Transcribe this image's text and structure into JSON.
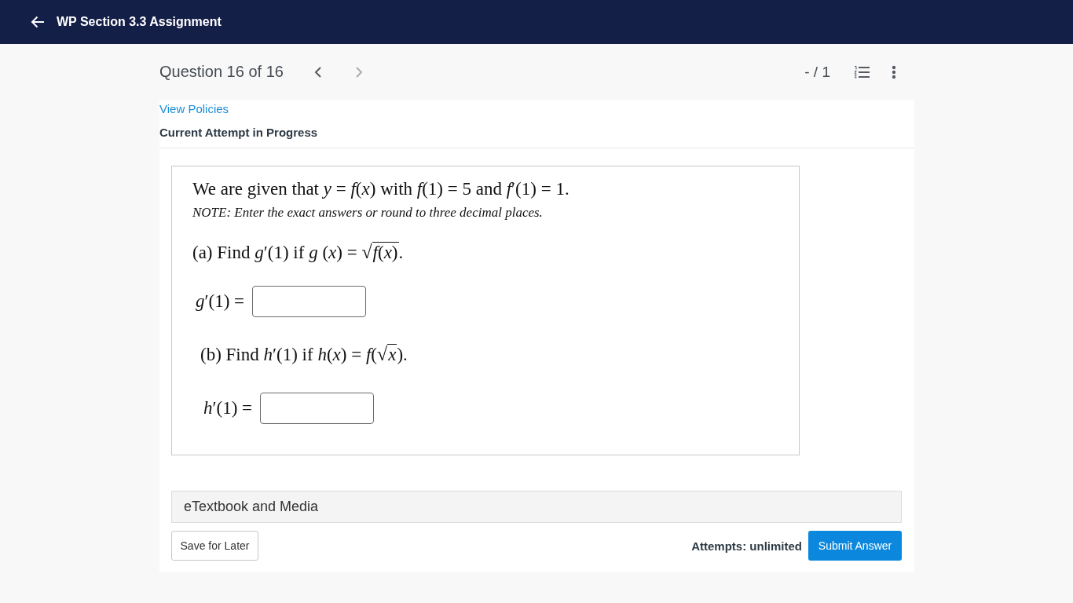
{
  "top_bar": {
    "title": "WP Section 3.3 Assignment"
  },
  "question_nav": {
    "title": "Question 16 of 16",
    "buttons": [
      {
        "kind": "previous",
        "disabled": false
      },
      {
        "kind": "next",
        "disabled": true
      }
    ],
    "score": "- / 1"
  },
  "policies_link": "View Policies",
  "attempt_status": "Current Attempt in Progress",
  "question": {
    "intro": "We are given that *y* = *f*(*x*) with *f*(1) = 5 and *f*′(1) = 1.",
    "note": "NOTE: Enter the exact answers or round to three decimal places.",
    "parts": [
      {
        "before": "(a) Find *g*′(1) if *g* (*x*) = ",
        "radical": "√",
        "radicand": "*f*(*x*)",
        "after": ".",
        "answer_label": "*g*′(1) ="
      },
      {
        "before": "(b) Find *h*′(1) if *h*(*x*) = *f*(",
        "radical": "√",
        "radicand": "*x*",
        "after": ").",
        "answer_label": "*h*′(1) ="
      }
    ]
  },
  "resources_bar": {
    "label": "eTextbook and Media"
  },
  "footer": {
    "save_button": "Save for Later",
    "attempts": "Attempts: unlimited",
    "submit_button": "Submit Answer"
  }
}
